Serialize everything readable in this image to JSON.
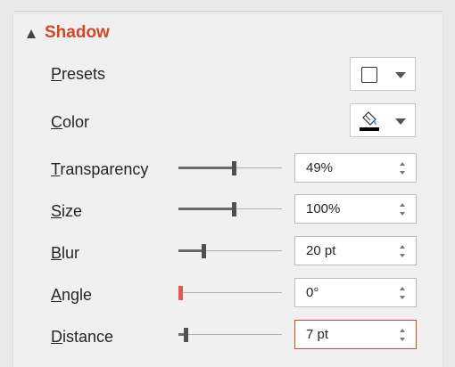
{
  "section": {
    "title": "Shadow"
  },
  "rows": {
    "presets": {
      "label_first": "P",
      "label_rest": "resets"
    },
    "color": {
      "label_first": "C",
      "label_rest": "olor"
    },
    "transparency": {
      "label_first": "T",
      "label_rest": "ransparency",
      "value": "49%",
      "level": 0.49
    },
    "size": {
      "label_first": "S",
      "label_rest": "ize",
      "value": "100%",
      "level": 0.5
    },
    "blur": {
      "label_first": "B",
      "label_rest": "lur",
      "value": "20 pt",
      "level": 0.2
    },
    "angle": {
      "label_first": "A",
      "label_rest": "ngle",
      "value": "0°",
      "level": 0.0
    },
    "distance": {
      "label_first": "D",
      "label_rest": "istance",
      "value": "7 pt",
      "level": 0.04
    }
  },
  "colors": {
    "accent": "#d24726",
    "active_thumb": "#e8584e",
    "color_swatch": "#000000"
  },
  "icons": {
    "preset": "shadow-preset-icon",
    "color": "paint-bucket-icon"
  }
}
